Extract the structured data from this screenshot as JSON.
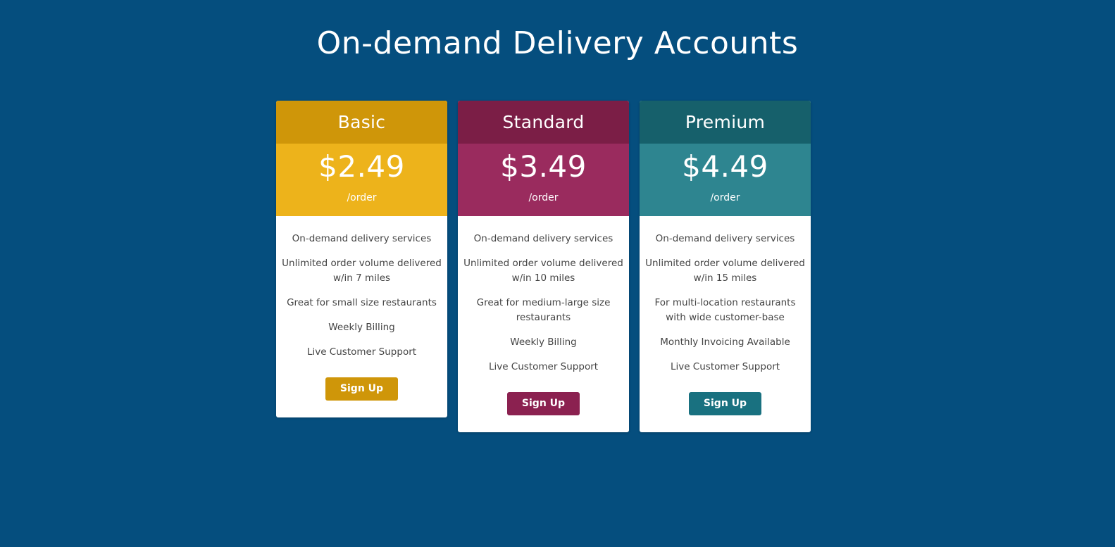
{
  "header": {
    "title": "On-demand Delivery Accounts"
  },
  "theme": {
    "page_background": "#054e7e",
    "card_background": "#ffffff",
    "feature_text": "#444444"
  },
  "plans": [
    {
      "name": "Basic",
      "price": "$2.49",
      "period": "/order",
      "header_color": "#cf9609",
      "price_color": "#edb31b",
      "button_color": "#cf9609",
      "signup_label": "Sign Up",
      "features": [
        "On-demand delivery services",
        "Unlimited order volume delivered w/in 7 miles",
        "Great for small size restaurants",
        "Weekly Billing",
        "Live Customer Support"
      ]
    },
    {
      "name": "Standard",
      "price": "$3.49",
      "period": "/order",
      "header_color": "#7b1e46",
      "price_color": "#9a2b5e",
      "button_color": "#8b2150",
      "signup_label": "Sign Up",
      "features": [
        "On-demand delivery services",
        "Unlimited order volume delivered w/in 10 miles",
        "Great for medium-large size restaurants",
        "Weekly Billing",
        "Live Customer Support"
      ]
    },
    {
      "name": "Premium",
      "price": "$4.49",
      "period": "/order",
      "header_color": "#16606b",
      "price_color": "#2e8590",
      "button_color": "#197180",
      "signup_label": "Sign Up",
      "features": [
        "On-demand delivery services",
        "Unlimited order volume delivered w/in 15 miles",
        "For multi-location restaurants with wide customer-base",
        "Monthly Invoicing Available",
        "Live Customer Support"
      ]
    }
  ]
}
